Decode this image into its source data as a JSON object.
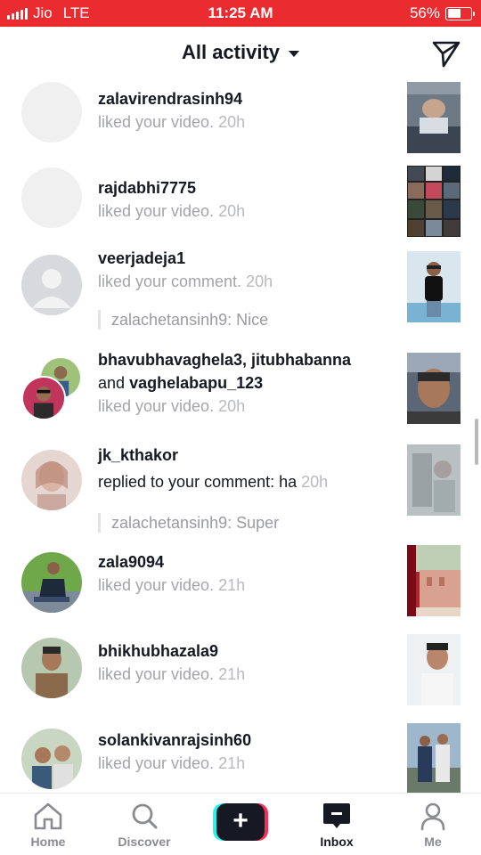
{
  "status_bar": {
    "carrier": "Jio",
    "network": "LTE",
    "time": "11:25 AM",
    "battery_text": "56%",
    "battery_level": 0.56,
    "background": "#ea2c31"
  },
  "header": {
    "title": "All activity",
    "dropdown_icon": "caret-down-icon",
    "direct_message_icon": "paper-plane-icon"
  },
  "activity": [
    {
      "username": "zalavirendrasinh94",
      "action": "liked your video.",
      "time": "20h",
      "avatar": "blank"
    },
    {
      "username": "rajdabhi7775",
      "action": "liked your video.",
      "time": "20h",
      "avatar": "blank"
    },
    {
      "username": "veerjadeja1",
      "action": "liked your comment.",
      "time": "20h",
      "quote": "zalachetansinh9: Nice",
      "avatar": "default"
    },
    {
      "username": "bhavubhavaghela3, jitubhabanna",
      "connector": "and",
      "username2": "vaghelabapu_123",
      "action": "liked your video.",
      "time": "20h",
      "avatar": "stacked"
    },
    {
      "username": "jk_kthakor",
      "action": "replied to your comment: ha",
      "time": "20h",
      "quote": "zalachetansinh9: Super",
      "avatar": "photo"
    },
    {
      "username": "zala9094",
      "action": "liked your video.",
      "time": "21h",
      "avatar": "photo"
    },
    {
      "username": "bhikhubhazala9",
      "action": "liked your video.",
      "time": "21h",
      "avatar": "photo"
    },
    {
      "username": "solankivanrajsinh60",
      "action": "liked your video.",
      "time": "21h",
      "avatar": "photo"
    }
  ],
  "bottom_nav": {
    "items": [
      {
        "label": "Home",
        "icon": "home-icon"
      },
      {
        "label": "Discover",
        "icon": "search-icon"
      },
      {
        "label": "",
        "icon": "create-plus-icon"
      },
      {
        "label": "Inbox",
        "icon": "inbox-icon",
        "active": true
      },
      {
        "label": "Me",
        "icon": "profile-icon"
      }
    ],
    "create_symbol": "+"
  }
}
